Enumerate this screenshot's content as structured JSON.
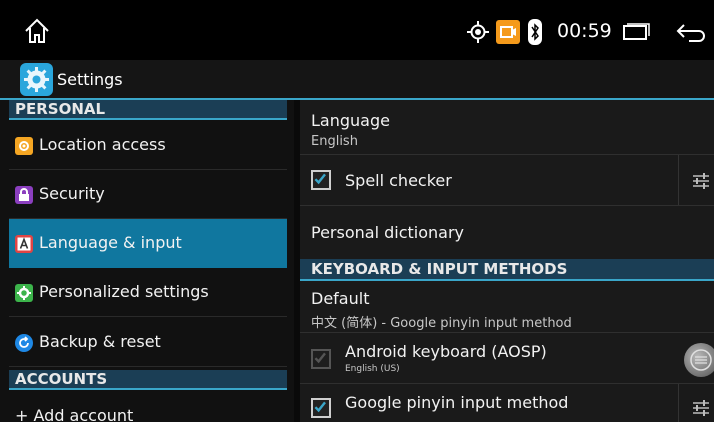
{
  "status_bar": {
    "time": "00:59",
    "icons": [
      "home-icon",
      "gps-icon",
      "camera-icon",
      "bluetooth-icon",
      "recent-apps-icon",
      "back-icon"
    ],
    "camera_color": "#f59a1b"
  },
  "action_bar": {
    "title": "Settings",
    "icon": "settings-gear-icon",
    "accent": "#3aa6c9"
  },
  "sidebar": {
    "personal_header": "PERSONAL",
    "items": [
      {
        "label": "Location access",
        "icon": "location-icon",
        "color": "#f5a623"
      },
      {
        "label": "Security",
        "icon": "lock-icon",
        "color": "#8b3fbf"
      },
      {
        "label": "Language & input",
        "icon": "keyboard-a-icon",
        "color": "#e04444",
        "active": true
      },
      {
        "label": "Personalized settings",
        "icon": "gear-icon",
        "color": "#3cb44b"
      },
      {
        "label": "Backup & reset",
        "icon": "backup-icon",
        "color": "#1e88e5"
      }
    ],
    "accounts_header": "ACCOUNTS",
    "add_account": "+ Add account"
  },
  "main": {
    "language": {
      "title": "Language",
      "value": "English"
    },
    "spell_checker": {
      "label": "Spell checker",
      "checked": true
    },
    "personal_dictionary": {
      "title": "Personal dictionary"
    },
    "keyboard_header": "KEYBOARD & INPUT METHODS",
    "default": {
      "title": "Default",
      "value": "中文 (简体) - Google pinyin input method"
    },
    "keyboards": [
      {
        "label": "Android keyboard (AOSP)",
        "sub": "English (US)",
        "checked": true,
        "enabled": false
      },
      {
        "label": "Google pinyin input method",
        "sub": "",
        "checked": true,
        "enabled": true
      }
    ]
  }
}
